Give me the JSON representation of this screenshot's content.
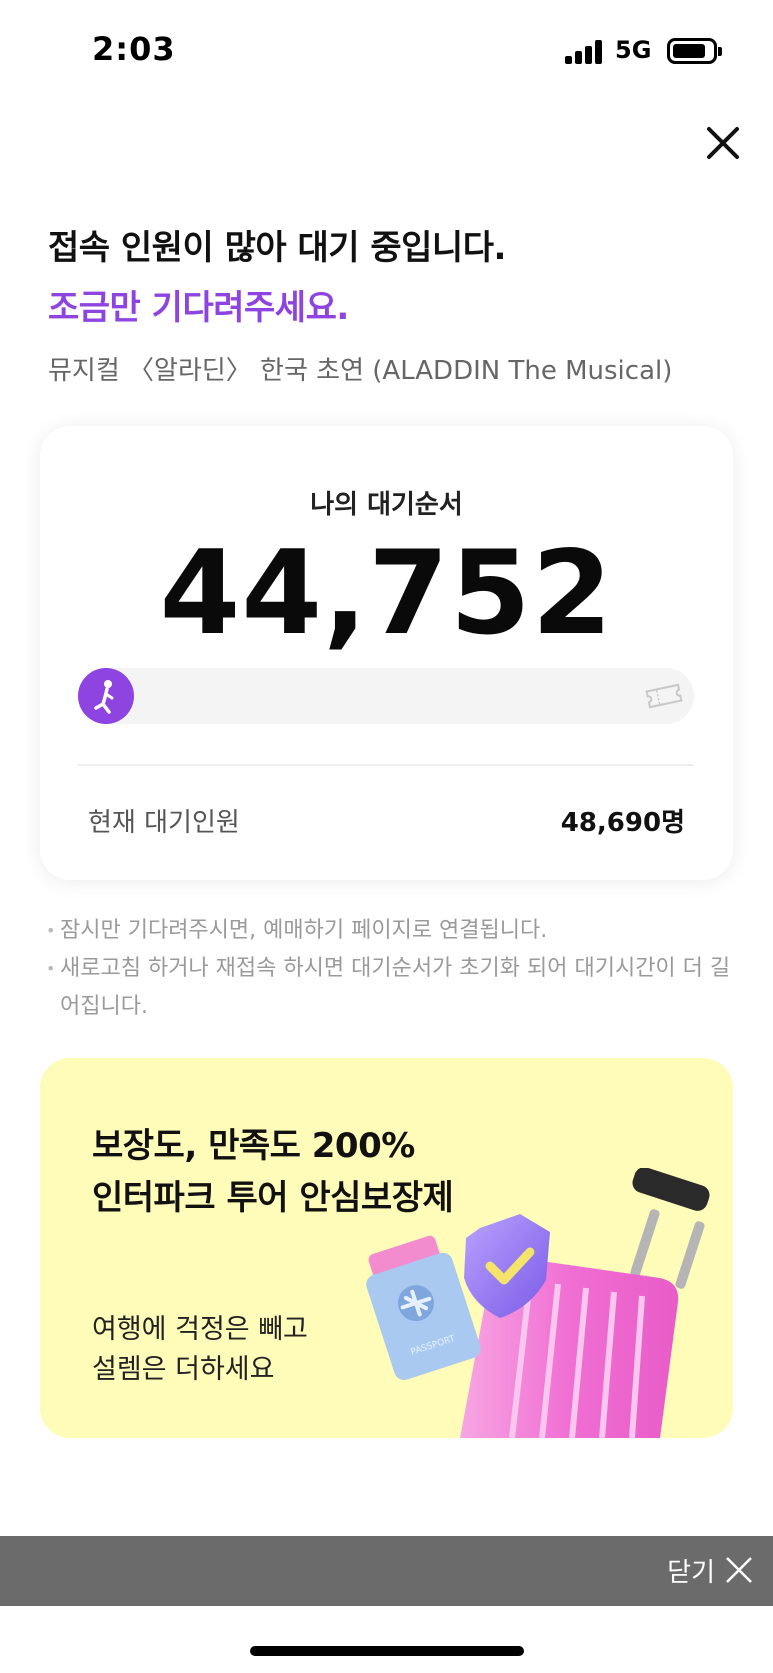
{
  "status_bar": {
    "time": "2:03",
    "network": "5G",
    "signal_bars": 4,
    "battery_level": 0.85
  },
  "header": {
    "headline": "접속 인원이 많아 대기 중입니다.",
    "subheadline": "조금만 기다려주세요.",
    "show_title": "뮤지컬 〈알라딘〉 한국 초연 (ALADDIN The Musical)",
    "close_icon": "close-icon"
  },
  "queue_card": {
    "label": "나의 대기순서",
    "position": "44,752",
    "progress": 0.0,
    "progress_icons": {
      "start": "walking-person-icon",
      "end": "ticket-icon"
    },
    "total_label": "현재 대기인원",
    "total_value": "48,690명"
  },
  "notices": [
    "잠시만 기다려주시면, 예매하기 페이지로 연결됩니다.",
    "새로고침 하거나 재접속 하시면 대기순서가 초기화 되어 대기시간이 더 길어집니다."
  ],
  "ad_banner": {
    "title_line1": "보장도, 만족도 200%",
    "title_line2": "인터파크 투어 안심보장제",
    "subtitle_line1": "여행에 걱정은 빼고",
    "subtitle_line2": "설렘은 더하세요",
    "passport_text": "PASSPORT",
    "background_color": "#fffcb9",
    "accent_color": "#8e44e0"
  },
  "bottom_bar": {
    "close_label": "닫기",
    "close_icon": "close-icon"
  },
  "colors": {
    "accent": "#8e44e0",
    "bottom_bar": "#6b6b6b"
  }
}
